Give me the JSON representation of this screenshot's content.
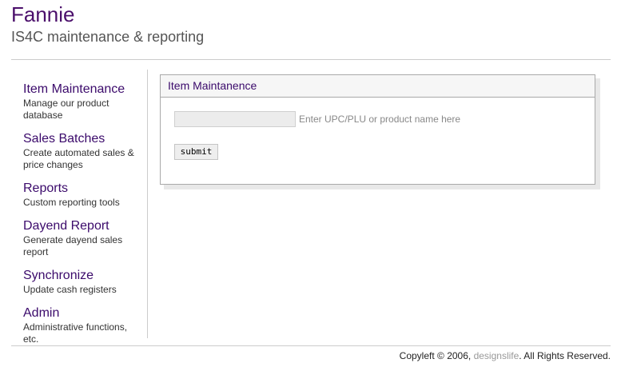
{
  "header": {
    "title": "Fannie",
    "subtitle": "IS4C maintenance & reporting"
  },
  "sidebar": {
    "items": [
      {
        "label": "Item Maintenance",
        "description": "Manage our product database"
      },
      {
        "label": "Sales Batches",
        "description": "Create automated sales & price changes"
      },
      {
        "label": "Reports",
        "description": "Custom reporting tools"
      },
      {
        "label": "Dayend Report",
        "description": "Generate dayend sales report"
      },
      {
        "label": "Synchronize",
        "description": "Update cash registers"
      },
      {
        "label": "Admin",
        "description": "Administrative functions, etc."
      }
    ]
  },
  "panel": {
    "title": "Item Maintanence",
    "search": {
      "value": "",
      "placeholder": "",
      "hint": "Enter UPC/PLU or product name here"
    },
    "submit_label": "submit"
  },
  "footer": {
    "prefix": "Copyleft © 2006, ",
    "link": "designslife",
    "suffix": ". All Rights Reserved."
  },
  "colors": {
    "title": "#4b0f6b",
    "link": "#3b0a6b",
    "border": "#a9a9a9"
  }
}
